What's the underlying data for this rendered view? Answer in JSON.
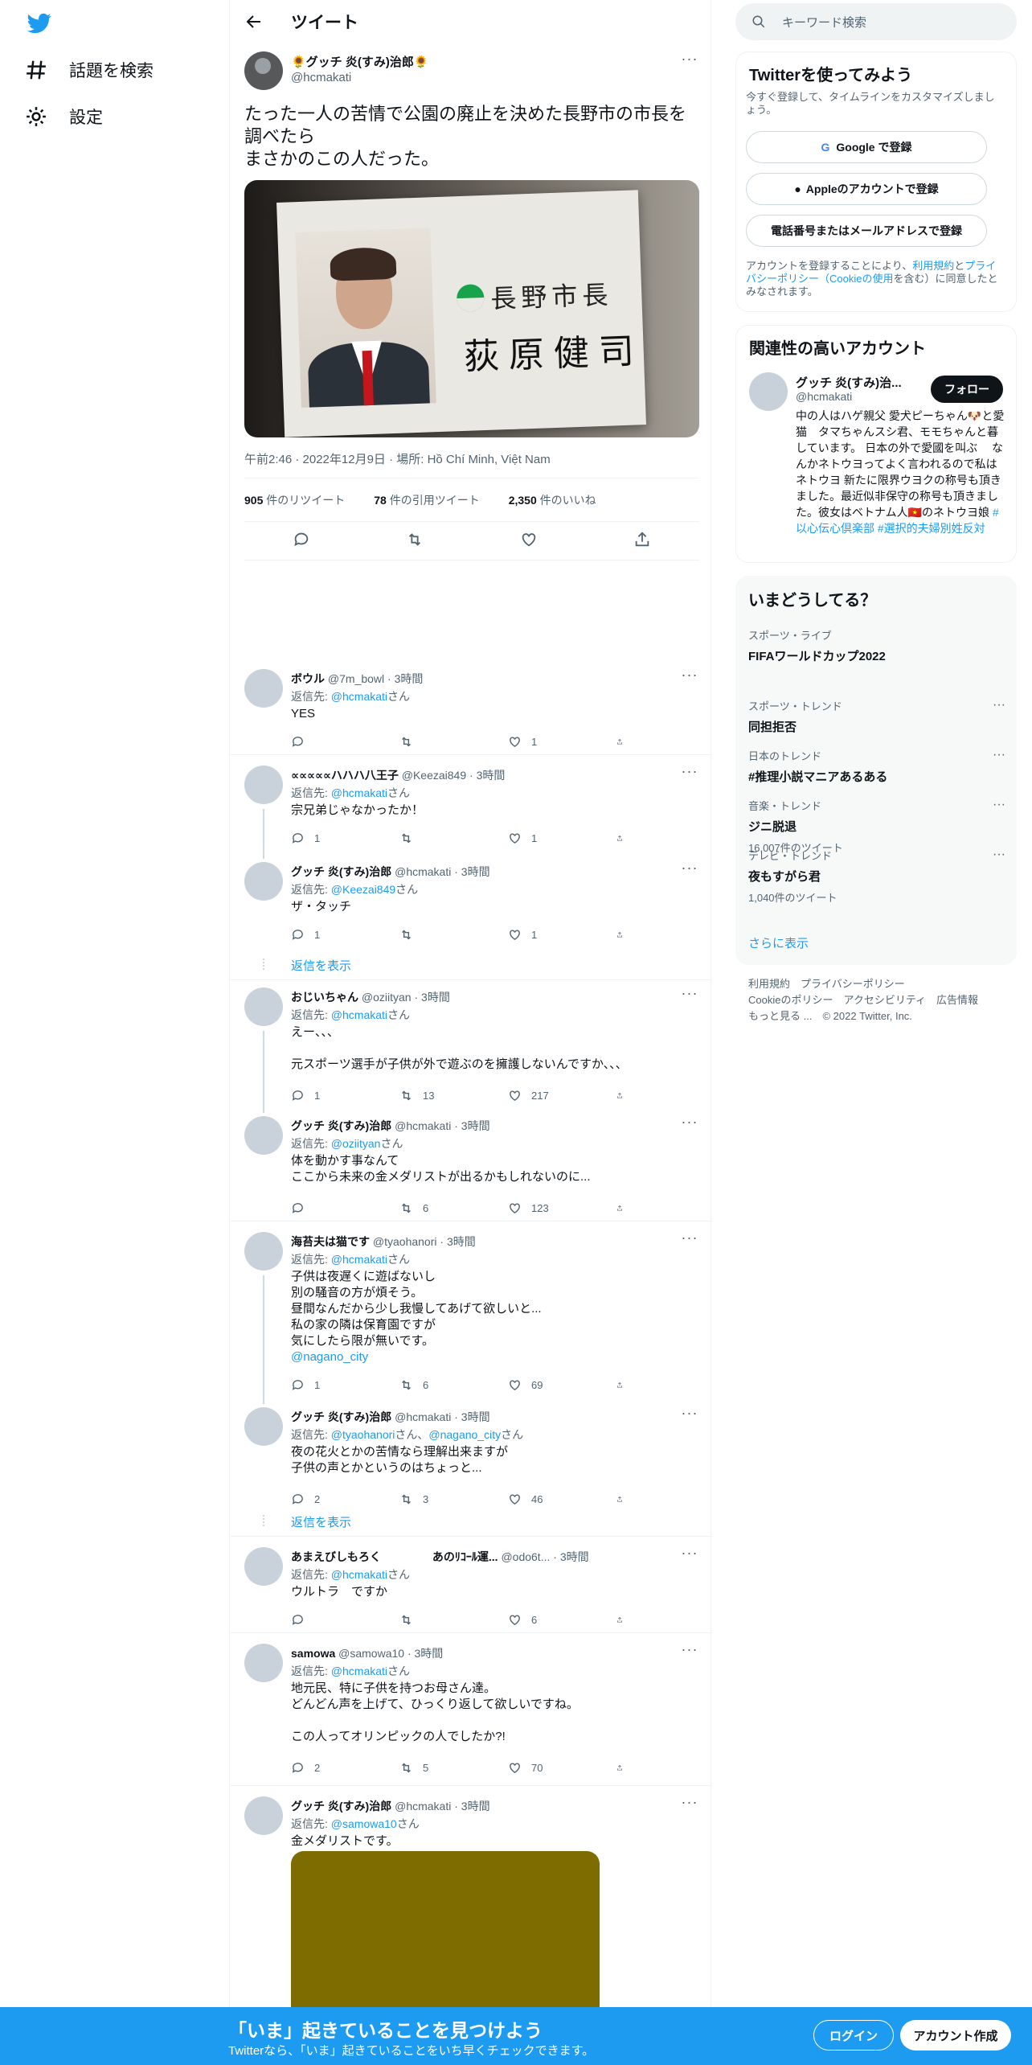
{
  "colors": {
    "accent": "#1d9bf0",
    "text": "#0f1419",
    "muted": "#536471"
  },
  "nav": {
    "explore": "話題を検索",
    "settings": "設定"
  },
  "header": {
    "title": "ツイート"
  },
  "tweet": {
    "name": "🌻グッチ 炎(すみ)治郎🌻",
    "handle": "@hcmakati",
    "text": "たった一人の苦情で公園の廃止を決めた長野市の市長を調べたら\nまさかのこの人だった。",
    "card_title": "長野市長",
    "card_name": "荻原健司",
    "meta": "午前2:46 · 2022年12月9日 · 場所: Hồ Chí Minh, Việt Nam",
    "retweets": "905",
    "retweets_label": "件のリツイート",
    "quotes": "78",
    "quotes_label": "件の引用ツイート",
    "likes": "2,350",
    "likes_label": "件のいいね"
  },
  "replies": [
    {
      "name": "ボウル",
      "handle": "@7m_bowl",
      "time": "3時間",
      "to": "@hcmakati",
      "san": "さん",
      "body": "YES",
      "reply": "",
      "rt": "",
      "like": "1"
    },
    {
      "name": "∝∝∝∝∝ハハハ八王子",
      "handle": "@Keezai849",
      "time": "3時間",
      "to": "@hcmakati",
      "san": "さん",
      "body": "宗兄弟じゃなかったか！",
      "reply": "1",
      "rt": "",
      "like": "1"
    },
    {
      "name": "グッチ 炎(すみ)治郎",
      "handle": "@hcmakati",
      "time": "3時間",
      "to": "@Keezai849",
      "san": "さん",
      "body": "ザ・タッチ",
      "reply": "1",
      "rt": "",
      "like": "1"
    },
    {
      "name": "おじいちゃん",
      "handle": "@oziityan",
      "time": "3時間",
      "to": "@hcmakati",
      "san": "さん",
      "body": "えー、、、\n\n元スポーツ選手が子供が外で遊ぶのを擁護しないんですか、、、",
      "reply": "1",
      "rt": "13",
      "like": "217"
    },
    {
      "name": "グッチ 炎(すみ)治郎",
      "handle": "@hcmakati",
      "time": "3時間",
      "to": "@oziityan",
      "san": "さん",
      "body": "体を動かす事なんて\nここから未来の金メダリストが出るかもしれないのに...",
      "reply": "",
      "rt": "6",
      "like": "123"
    },
    {
      "name": "海苔夫は猫です",
      "handle": "@tyaohanori",
      "time": "3時間",
      "to": "@hcmakati",
      "san": "さん",
      "body": "子供は夜遅くに遊ばないし\n別の騒音の方が煩そう。\n昼間なんだから少し我慢してあげて欲しいと...\n私の家の隣は保育園ですが\n気にしたら限が無いです。",
      "link": "@nagano_city",
      "reply": "1",
      "rt": "6",
      "like": "69"
    },
    {
      "name": "グッチ 炎(すみ)治郎",
      "handle": "@hcmakati",
      "time": "3時間",
      "to": "@tyaohanori",
      "to2": "@nagano_city",
      "san": "さん",
      "body": "夜の花火とかの苦情なら理解出来ますが\n子供の声とかというのはちょっと...",
      "reply": "2",
      "rt": "3",
      "like": "46"
    },
    {
      "name": "あまえびしもろく",
      "name2": "あのﾘｺｰﾙ運...",
      "handle": "@odo6t...",
      "time": "3時間",
      "to": "@hcmakati",
      "san": "さん",
      "body": "ウルトラ　ですか",
      "reply": "",
      "rt": "",
      "like": "6"
    },
    {
      "name": "samowa",
      "handle": "@samowa10",
      "time": "3時間",
      "to": "@hcmakati",
      "san": "さん",
      "body": "地元民、特に子供を持つお母さん達。\nどんどん声を上げて、ひっくり返して欲しいですね。\n\nこの人ってオリンピックの人でしたか?!",
      "reply": "2",
      "rt": "5",
      "like": "70"
    },
    {
      "name": "グッチ 炎(すみ)治郎",
      "handle": "@hcmakati",
      "time": "3時間",
      "to": "@samowa10",
      "san": "さん",
      "body": "金メダリストです。",
      "reply": "",
      "rt": "",
      "like": ""
    }
  ],
  "reply_prefix": "返信先: ",
  "show_replies": "返信を表示",
  "search": {
    "placeholder": "キーワード検索"
  },
  "signup": {
    "title": "Twitterを使ってみよう",
    "sub": "今すぐ登録して、タイムラインをカスタマイズしましょう。",
    "google": "Google で登録",
    "apple": "Appleのアカウントで登録",
    "phone": "電話番号またはメールアドレスで登録",
    "terms_a": "アカウントを登録することにより、",
    "terms_link1": "利用規約",
    "terms_b": "と",
    "terms_link2": "プライバシーポリシー（Cookieの使用",
    "terms_c": "を含む）に同意したとみなされます。"
  },
  "related": {
    "title": "関連性の高いアカウント",
    "name": "グッチ 炎(すみ)治...",
    "handle": "@hcmakati",
    "follow": "フォロー",
    "bio": "中の人はハゲ親父 愛犬ピーちゃん🐶と愛猫　タマちゃんスシ君、モモちゃんと暮しています。 日本の外で愛國を叫ぶ　 なんかネトウヨってよく言われるので私はネトウヨ 新たに限界ウヨクの称号も頂きました。最近似非保守の称号も頂きました。彼女はベトナム人🇻🇳のネトウヨ娘 ",
    "bio_tags": "#以心伝心倶楽部 #選択的夫婦別姓反対"
  },
  "trends": {
    "title": "いまどうしてる？",
    "items": [
      {
        "cat": "スポーツ・ライブ",
        "title": "FIFAワールドカップ2022",
        "count": ""
      },
      {
        "cat": "スポーツ・トレンド",
        "title": "同担拒否",
        "count": ""
      },
      {
        "cat": "日本のトレンド",
        "title": "#推理小説マニアあるある",
        "count": ""
      },
      {
        "cat": "音楽・トレンド",
        "title": "ジニ脱退",
        "count": "16,007件のツイート"
      },
      {
        "cat": "テレビ・トレンド",
        "title": "夜もすがら君",
        "count": "1,040件のツイート"
      }
    ],
    "more": "さらに表示"
  },
  "footer": {
    "l1": "利用規約　プライバシーポリシー",
    "l2": "Cookieのポリシー　アクセシビリティ　広告情報",
    "l3": "もっと見る ...　© 2022 Twitter, Inc."
  },
  "bottom": {
    "title": "「いま」起きていることを見つけよう",
    "sub": "Twitterなら、「いま」起きていることをいち早くチェックできます。",
    "login": "ログイン",
    "signup": "アカウント作成"
  }
}
